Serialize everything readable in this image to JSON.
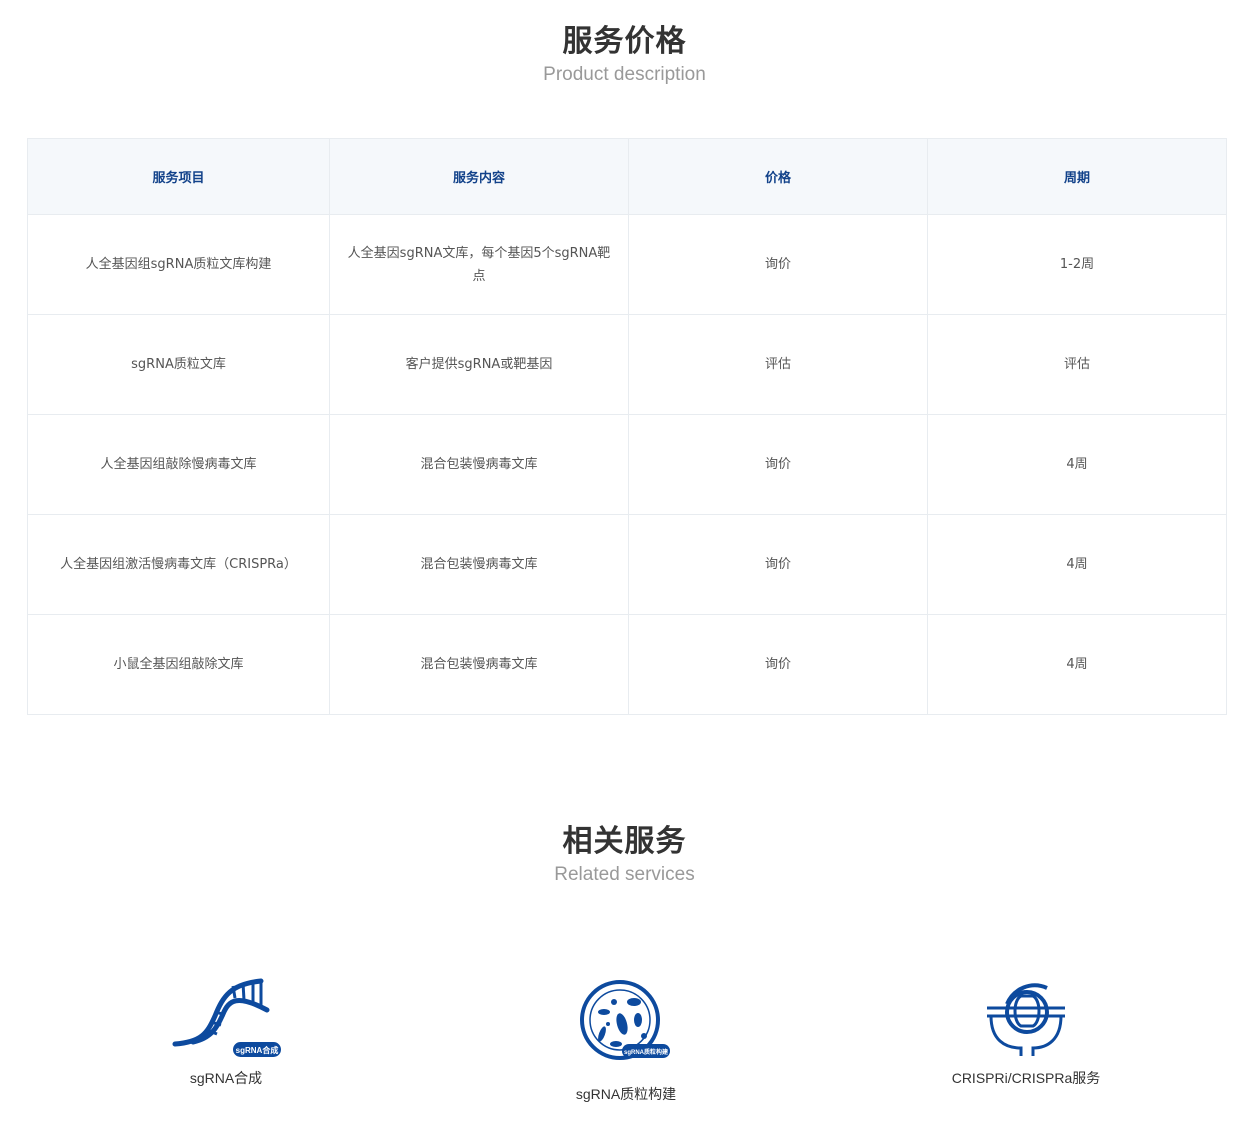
{
  "pricing": {
    "title": "服务价格",
    "subtitle": "Product description",
    "headers": [
      "服务项目",
      "服务内容",
      "价格",
      "周期"
    ],
    "rows": [
      [
        "人全基因组sgRNA质粒文库构建",
        "人全基因sgRNA文库，每个基因5个sgRNA靶点",
        "询价",
        "1-2周"
      ],
      [
        "sgRNA质粒文库",
        "客户提供sgRNA或靶基因",
        "评估",
        "评估"
      ],
      [
        "人全基因组敲除慢病毒文库",
        "混合包装慢病毒文库",
        "询价",
        "4周"
      ],
      [
        "人全基因组激活慢病毒文库（CRISPRa）",
        "混合包装慢病毒文库",
        "询价",
        "4周"
      ],
      [
        "小鼠全基因组敲除文库",
        "混合包装慢病毒文库",
        "询价",
        "4周"
      ]
    ]
  },
  "related": {
    "title": "相关服务",
    "subtitle": "Related services",
    "items": [
      {
        "label": "sgRNA合成",
        "icon": "dna-helix-icon",
        "badge": "sgRNA合成"
      },
      {
        "label": "sgRNA质粒构建",
        "icon": "petri-dish-icon",
        "badge": "sgRNA质粒构建"
      },
      {
        "label": "CRISPRi/CRISPRa服务",
        "icon": "crispr-mechanism-icon"
      }
    ]
  },
  "colors": {
    "brand": "#0d4a9e",
    "header_text": "#12428a",
    "header_bg": "#f5f8fb"
  }
}
